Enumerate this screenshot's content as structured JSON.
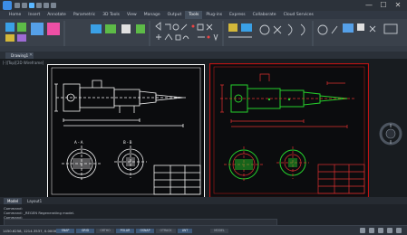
{
  "window": {
    "controls": [
      "—",
      "☐",
      "✕"
    ]
  },
  "ribbon": {
    "tabs": [
      "Home",
      "Insert",
      "Annotate",
      "Parametric",
      "3D Tools",
      "View",
      "Manage",
      "Output",
      "Tools",
      "Plug-ins",
      "Express",
      "Collaborate",
      "Cloud Services"
    ],
    "active_tab": "Tools"
  },
  "document": {
    "tab_label": "Drawing1",
    "close_glyph": "✕",
    "viewport_label": "[-][Top][2D Wireframe]"
  },
  "layout_tabs": [
    "Model",
    "Layout1"
  ],
  "command": {
    "history": [
      "Command:",
      "Command: _REGEN  Regenerating model.",
      "Command:"
    ]
  },
  "statusbar": {
    "coords": "1450.6258, 1214.3537, 0.0000",
    "toggles": [
      {
        "label": "SNAP",
        "on": true
      },
      {
        "label": "GRID",
        "on": true
      },
      {
        "label": "ORTHO",
        "on": false
      },
      {
        "label": "POLAR",
        "on": true
      },
      {
        "label": "OSNAP",
        "on": true
      },
      {
        "label": "OTRACK",
        "on": false
      },
      {
        "label": "LWT",
        "on": true
      },
      {
        "label": "MODEL",
        "on": false
      }
    ]
  },
  "colors": {
    "accent": "#3c8de6",
    "sheet_left_border": "#ffffff",
    "sheet_right_border": "#c01414",
    "green_geometry": "#26d02c",
    "red_geometry": "#e03030"
  }
}
